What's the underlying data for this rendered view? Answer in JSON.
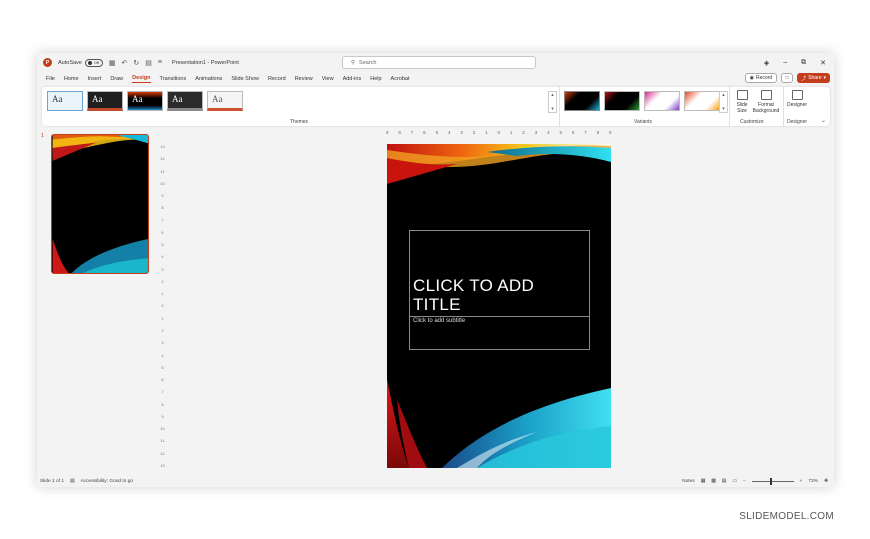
{
  "titlebar": {
    "autosave_label": "AutoSave",
    "autosave_state": "Off",
    "file_title": "Presentation1 - PowerPoint",
    "search_placeholder": "Search"
  },
  "menu": {
    "tabs": [
      "File",
      "Home",
      "Insert",
      "Draw",
      "Design",
      "Transitions",
      "Animations",
      "Slide Show",
      "Record",
      "Review",
      "View",
      "Add-ins",
      "Help",
      "Acrobat"
    ],
    "active_tab": "Design",
    "record_label": "Record",
    "share_label": "Share"
  },
  "ribbon": {
    "themes_label": "Themes",
    "theme_thumb_text": "Aa",
    "variants_label": "Variants",
    "customize_label": "Customize",
    "designer_label": "Designer",
    "slide_size": "Slide Size",
    "format_background": "Format Background",
    "designer_button": "Designer"
  },
  "thumbnails": {
    "slide_number": "1"
  },
  "ruler": {
    "horizontal": [
      "9",
      "8",
      "7",
      "6",
      "5",
      "4",
      "3",
      "2",
      "1",
      "0",
      "1",
      "2",
      "3",
      "4",
      "5",
      "6",
      "7",
      "8",
      "9"
    ],
    "vertical": [
      "13",
      "12",
      "11",
      "10",
      "9",
      "8",
      "7",
      "6",
      "5",
      "4",
      "3",
      "2",
      "1",
      "0",
      "1",
      "2",
      "3",
      "4",
      "5",
      "6",
      "7",
      "8",
      "9",
      "10",
      "11",
      "12",
      "13"
    ]
  },
  "slide": {
    "title_placeholder": "CLICK TO ADD TITLE",
    "subtitle_placeholder": "Click to add subtitle"
  },
  "status": {
    "slide_counter": "Slide 1 of 1",
    "accessibility": "Accessibility: Good to go",
    "notes_label": "Notes",
    "zoom_level": "73%"
  },
  "watermark": "SLIDEMODEL.COM",
  "colors": {
    "accent": "#c43e1c",
    "slide_bg": "#000000"
  }
}
